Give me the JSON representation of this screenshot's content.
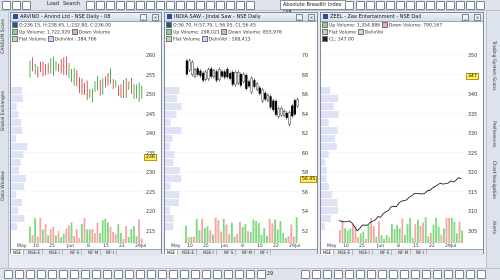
{
  "toolbar": {
    "load": "Load",
    "search": "Search",
    "absolute_breadth": "Absolute Breadth Index (AB"
  },
  "left_sidebar": [
    "CANSLIM Scans",
    "Global Exchanges",
    "Data Window"
  ],
  "right_sidebar": [
    "Trading System Scans",
    "Preferences",
    "Chart Navigation",
    "Alerts"
  ],
  "windows": [
    {
      "title": "ARVIND - Arvind Ltd - NSE Daily - 08",
      "ohlc": "O:236.15, H:238.65, L:232.80, C:236.00",
      "legend": [
        [
          "Up Volume: 1,722,029",
          "Down Volume"
        ],
        [
          "Flat Volume",
          "DelivVol : 384,766"
        ]
      ],
      "y_ticks": [
        "260",
        "255",
        "250",
        "245",
        "240",
        "235",
        "230",
        "225",
        "220",
        "215"
      ],
      "price_label": "236",
      "x_ticks": [
        "May",
        "10",
        "25",
        "Jun",
        "8",
        "15",
        "22",
        "29Jul"
      ],
      "tabs": [
        "NSE",
        "NSE-E",
        "NSE-I",
        "NF-S",
        "NF-M",
        "NF-I"
      ]
    },
    {
      "title": "INDIA SAW - Jindal Saw - NSE Daily",
      "ohlc": "O:56.70, H:57.70, L:56.05, CL:56.45",
      "legend": [
        [
          "Up Volume: 298,021",
          "Down Volume: 855,976"
        ],
        [
          "Flat Volume",
          "DelivVol : 168,413"
        ]
      ],
      "y_ticks": [
        "70",
        "68",
        "66",
        "64",
        "62",
        "60",
        "58",
        "56",
        "54",
        "52"
      ],
      "price_label": "56.45",
      "x_ticks": [
        "May",
        "10",
        "25",
        "Jun",
        "8",
        "15",
        "22",
        "29Jul"
      ],
      "tabs": [
        "NSE",
        "NSE-E",
        "NSE-I",
        "NF-S",
        "NF-M",
        "NF-I"
      ]
    },
    {
      "title": "ZEEL - Zee Entertainment - NSE Dail",
      "ohlc": "CL: 347.00",
      "legend": [
        [
          "Up Volume: 1,354,886",
          "Down Volume: 790,167"
        ],
        [
          "Flat Volume",
          "DelivVol"
        ]
      ],
      "y_ticks": [
        "350",
        "345",
        "340",
        "335",
        "330",
        "325",
        "320",
        "315",
        "310",
        "305"
      ],
      "price_label": "347",
      "x_ticks": [
        "May",
        "10",
        "25",
        "Jun",
        "8",
        "15",
        "22",
        "29Jul"
      ],
      "tabs": [
        "NSE",
        "NSE-E",
        "NSE-I",
        "NF-S",
        "NF-M",
        "NF-I"
      ]
    }
  ],
  "bottom_toolbar": {
    "zoom": "1:29"
  },
  "colors": {
    "up_candle": "#ffffff",
    "down_candle": "#000000",
    "up_bar_red": "#d03030",
    "up_bar_green": "#2f9a2f",
    "volume_green": "#7fd97f",
    "volume_pink": "#f2a7a7",
    "price_tag": "#ffee66",
    "title_blue": "#2a4e96"
  }
}
